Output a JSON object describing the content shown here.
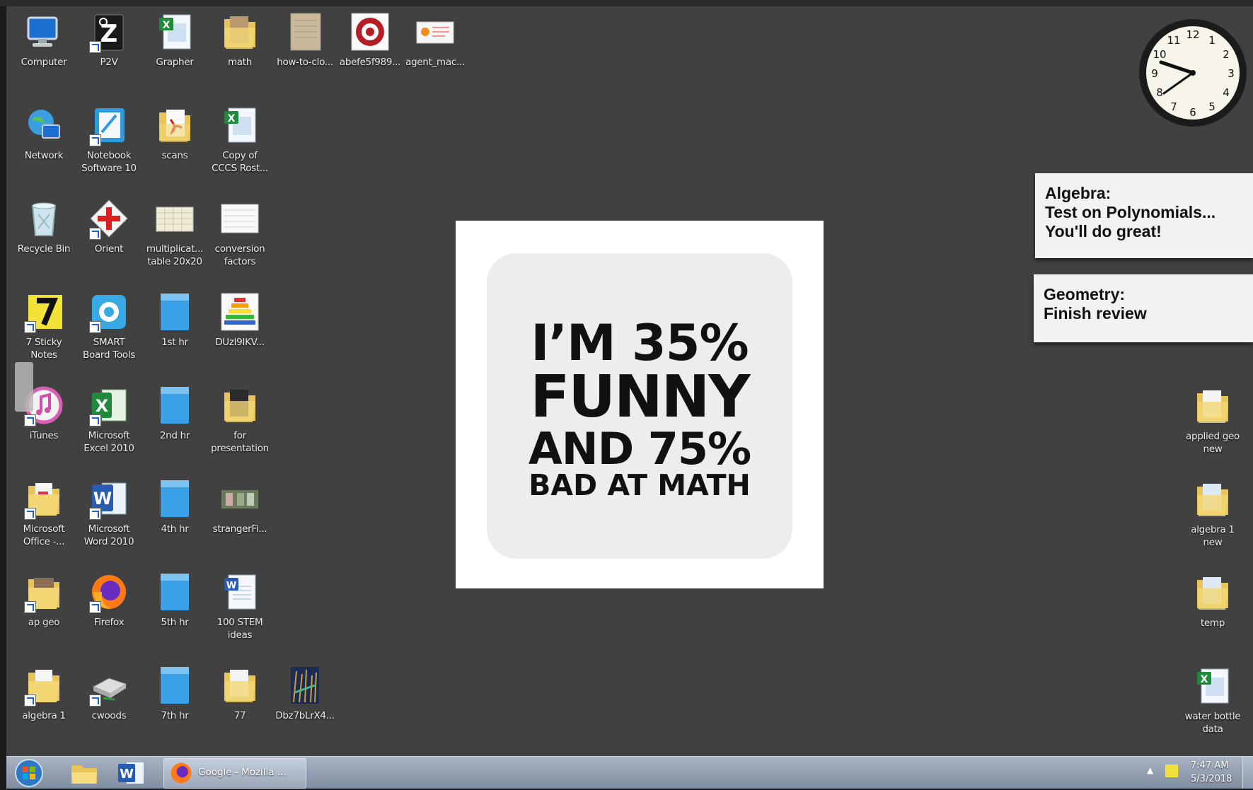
{
  "desktop_icons": [
    {
      "label": "Computer",
      "icon": "computer-icon"
    },
    {
      "label": "P2V",
      "icon": "p2v-icon"
    },
    {
      "label": "Grapher",
      "icon": "excel-file-icon"
    },
    {
      "label": "math",
      "icon": "folder-icon"
    },
    {
      "label": "how-to-clo...",
      "icon": "image-file-icon"
    },
    {
      "label": "abefe5f989...",
      "icon": "image-file-icon"
    },
    {
      "label": "agent_mac...",
      "icon": "image-file-icon"
    },
    {
      "label": "Network",
      "icon": "network-icon"
    },
    {
      "label": "Notebook",
      "label2": "Software 10",
      "icon": "notebook-icon"
    },
    {
      "label": "scans",
      "icon": "pdf-folder-icon"
    },
    {
      "label": "Copy of",
      "label2": "CCCS Rost...",
      "icon": "excel-file-icon"
    },
    {
      "label": "Recycle Bin",
      "icon": "recycle-bin-icon"
    },
    {
      "label": "Orient",
      "icon": "orient-icon"
    },
    {
      "label": "multiplicat...",
      "label2": "table 20x20",
      "icon": "image-file-icon"
    },
    {
      "label": "conversion",
      "label2": "factors",
      "icon": "image-file-icon"
    },
    {
      "label": "7 Sticky",
      "label2": "Notes",
      "icon": "sticky-notes-icon"
    },
    {
      "label": "SMART",
      "label2": "Board Tools",
      "icon": "smart-board-icon"
    },
    {
      "label": "1st hr",
      "icon": "blue-document-icon"
    },
    {
      "label": "DUzl9IKV...",
      "icon": "image-file-icon"
    },
    {
      "label": "iTunes",
      "icon": "itunes-icon"
    },
    {
      "label": "Microsoft",
      "label2": "Excel 2010",
      "icon": "excel-icon"
    },
    {
      "label": "2nd hr",
      "icon": "blue-document-icon"
    },
    {
      "label": "for",
      "label2": "presentation",
      "icon": "folder-icon"
    },
    {
      "label": "Microsoft",
      "label2": "Office -...",
      "icon": "office-folder-icon"
    },
    {
      "label": "Microsoft",
      "label2": "Word 2010",
      "icon": "word-icon"
    },
    {
      "label": "4th hr",
      "icon": "blue-document-icon"
    },
    {
      "label": "strangerFi...",
      "icon": "image-file-icon"
    },
    {
      "label": "ap geo",
      "icon": "folder-icon"
    },
    {
      "label": "Firefox",
      "icon": "firefox-icon"
    },
    {
      "label": "5th hr",
      "icon": "blue-document-icon"
    },
    {
      "label": "100 STEM",
      "label2": "ideas",
      "icon": "word-file-icon"
    },
    {
      "label": "algebra 1",
      "icon": "folder-icon"
    },
    {
      "label": "cwoods",
      "icon": "drive-icon"
    },
    {
      "label": "7th hr",
      "icon": "blue-document-icon"
    },
    {
      "label": "77",
      "icon": "folder-icon"
    },
    {
      "label": "Dbz7bLrX4...",
      "icon": "image-file-icon"
    },
    {
      "label": "applied geo",
      "label2": "new",
      "icon": "folder-icon"
    },
    {
      "label": "algebra 1",
      "label2": "new",
      "icon": "folder-icon"
    },
    {
      "label": "temp",
      "icon": "folder-icon"
    },
    {
      "label": "water bottle",
      "label2": "data",
      "icon": "excel-file-icon"
    }
  ],
  "poster": {
    "line1": "I’M 35%",
    "line2": "FUNNY",
    "line3": "AND 75%",
    "line4": "BAD AT MATH"
  },
  "sticky_notes": [
    {
      "line1": "Algebra:",
      "line2": "Test on Polynomials...",
      "line3": "You'll do great!"
    },
    {
      "line1": "Geometry:",
      "line2": "Finish review"
    }
  ],
  "clock": {
    "time_hint": "7:47"
  },
  "taskbar": {
    "firefox_task_label": "Google - Mozilla ...",
    "time": "7:47 AM",
    "date": "5/3/2018"
  }
}
